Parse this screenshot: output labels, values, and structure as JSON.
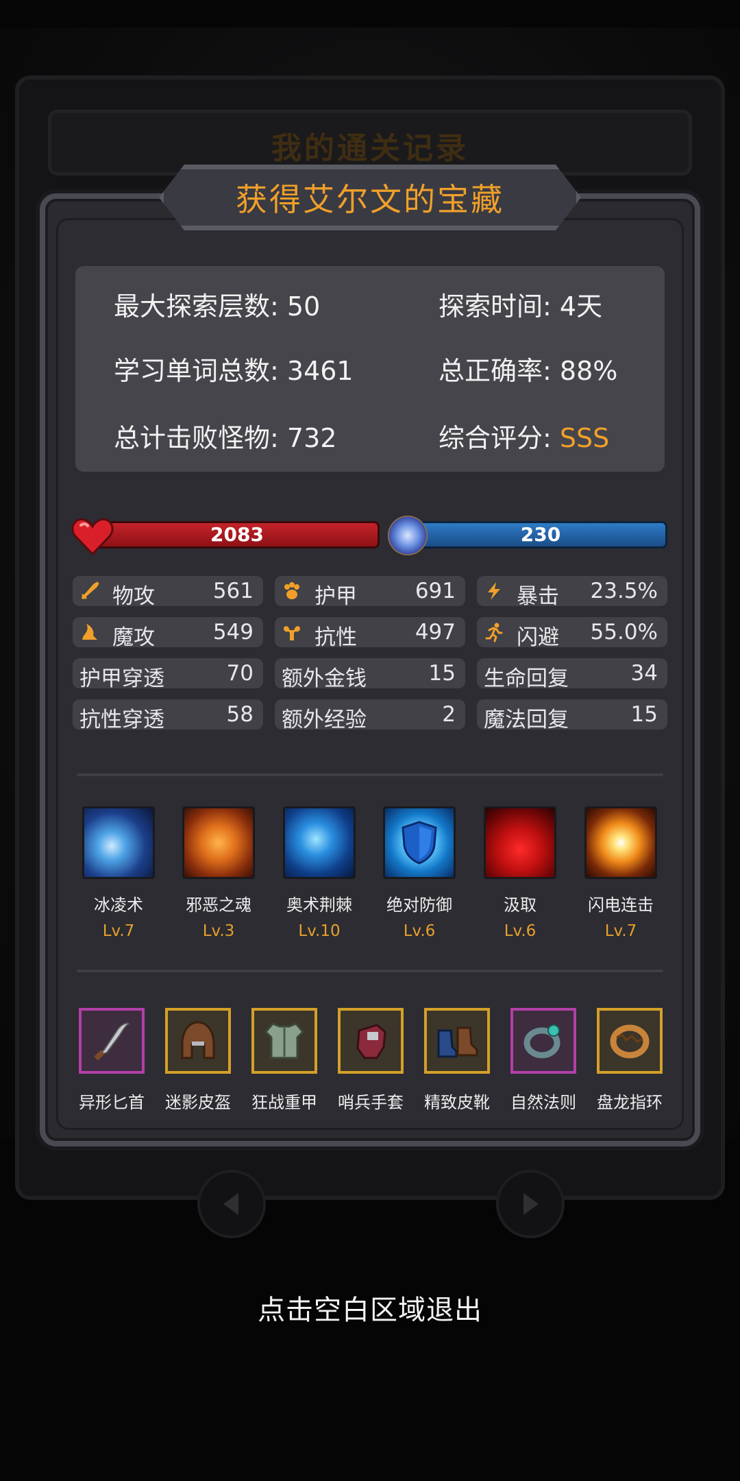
{
  "back_title": "我的通关记录",
  "title": "获得艾尔文的宝藏",
  "summary": {
    "max_floor_label": "最大探索层数: ",
    "max_floor": "50",
    "explore_time_label": "探索时间: ",
    "explore_time": "4天",
    "words_label": "学习单词总数: ",
    "words": "3461",
    "accuracy_label": "总正确率: ",
    "accuracy": "88%",
    "monsters_label": "总计击败怪物: ",
    "monsters": "732",
    "rating_label": "综合评分: ",
    "rating": "SSS"
  },
  "bars": {
    "hp": "2083",
    "mp": "230"
  },
  "stats": [
    {
      "label": "物攻",
      "value": "561",
      "icon": "sword-icon"
    },
    {
      "label": "护甲",
      "value": "691",
      "icon": "paw-icon"
    },
    {
      "label": "暴击",
      "value": "23.5%",
      "icon": "lightning-icon"
    },
    {
      "label": "魔攻",
      "value": "549",
      "icon": "magic-hat-icon"
    },
    {
      "label": "抗性",
      "value": "497",
      "icon": "muscle-icon"
    },
    {
      "label": "闪避",
      "value": "55.0%",
      "icon": "running-icon"
    },
    {
      "label": "护甲穿透",
      "value": "70"
    },
    {
      "label": "额外金钱",
      "value": "15"
    },
    {
      "label": "生命回复",
      "value": "34"
    },
    {
      "label": "抗性穿透",
      "value": "58"
    },
    {
      "label": "额外经验",
      "value": "2"
    },
    {
      "label": "魔法回复",
      "value": "15"
    }
  ],
  "skills": [
    {
      "name": "冰凌术",
      "level": "Lv.7"
    },
    {
      "name": "邪恶之魂",
      "level": "Lv.3"
    },
    {
      "name": "奥术荆棘",
      "level": "Lv.10"
    },
    {
      "name": "绝对防御",
      "level": "Lv.6"
    },
    {
      "name": "汲取",
      "level": "Lv.6"
    },
    {
      "name": "闪电连击",
      "level": "Lv.7"
    }
  ],
  "gear": [
    {
      "name": "异形匕首",
      "icon": "dagger-icon",
      "rarity": "purple"
    },
    {
      "name": "迷影皮盔",
      "icon": "helmet-icon",
      "rarity": "gold"
    },
    {
      "name": "狂战重甲",
      "icon": "armor-icon",
      "rarity": "gold"
    },
    {
      "name": "哨兵手套",
      "icon": "gloves-icon",
      "rarity": "gold"
    },
    {
      "name": "精致皮靴",
      "icon": "boots-icon",
      "rarity": "gold"
    },
    {
      "name": "自然法则",
      "icon": "ring-icon",
      "rarity": "purple"
    },
    {
      "name": "盘龙指环",
      "icon": "dragon-ring-icon",
      "rarity": "gold"
    }
  ],
  "exit_hint": "点击空白区域退出",
  "colors": {
    "accent_gold": "#f0a02a",
    "hp_red": "#c4232a",
    "mp_blue": "#2f7bc6"
  }
}
